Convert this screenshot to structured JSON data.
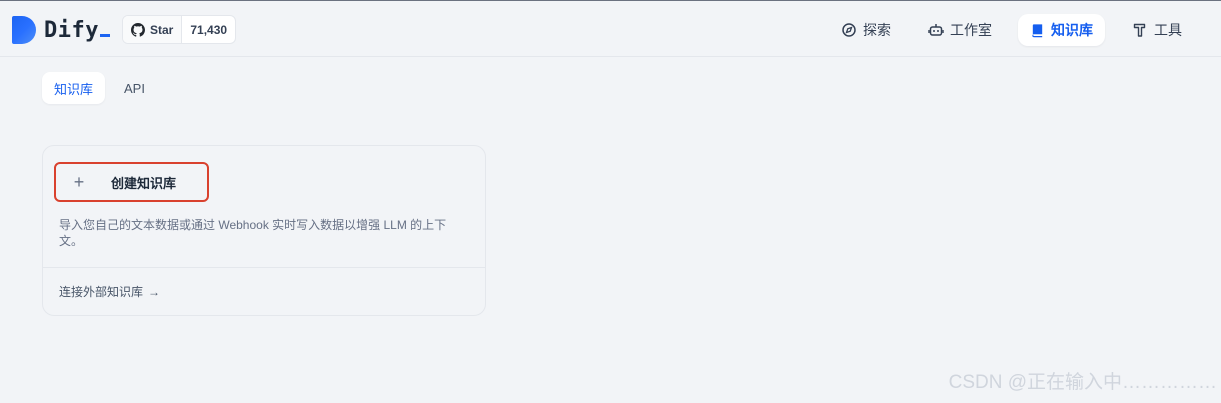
{
  "app": {
    "brand": "Dify",
    "accent_color": "#155eef"
  },
  "github": {
    "star_label": "Star",
    "star_count": "71,430",
    "icon": "github-icon"
  },
  "nav": [
    {
      "label": "探索",
      "icon": "compass-icon",
      "active": false
    },
    {
      "label": "工作室",
      "icon": "robot-icon",
      "active": false
    },
    {
      "label": "知识库",
      "icon": "book-icon",
      "active": true
    },
    {
      "label": "工具",
      "icon": "hammer-icon",
      "active": false
    }
  ],
  "tabs": [
    {
      "label": "知识库",
      "active": true
    },
    {
      "label": "API",
      "active": false
    }
  ],
  "create_card": {
    "plus_glyph": "+",
    "button_label": "创建知识库",
    "description": "导入您自己的文本数据或通过 Webhook 实时写入数据以增强 LLM 的上下文。",
    "external_link": "连接外部知识库",
    "external_arrow": "→",
    "highlight_color": "#d9412e"
  },
  "watermark": "CSDN @正在输入中……………"
}
